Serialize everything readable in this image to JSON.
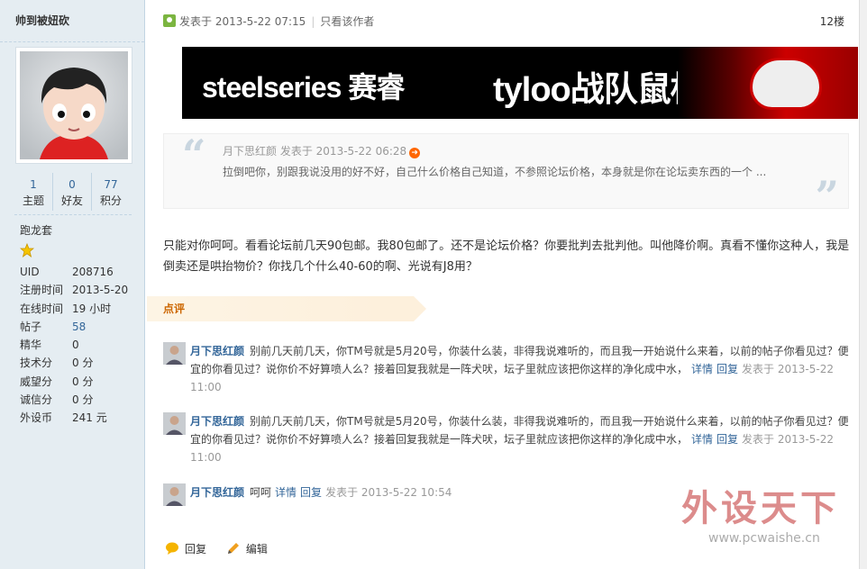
{
  "author": {
    "username": "帅到被妞砍",
    "stats": [
      {
        "value": "1",
        "label": "主题"
      },
      {
        "value": "0",
        "label": "好友"
      },
      {
        "value": "77",
        "label": "积分"
      }
    ],
    "rank": "跑龙套",
    "info": [
      {
        "key": "UID",
        "value": "208716"
      },
      {
        "key": "注册时间",
        "value": "2013-5-20"
      },
      {
        "key": "在线时间",
        "value": "19 小时"
      },
      {
        "key": "帖子",
        "value": "58"
      },
      {
        "key": "精华",
        "value": "0"
      },
      {
        "key": "技术分",
        "value": "0 分"
      },
      {
        "key": "威望分",
        "value": "0 分"
      },
      {
        "key": "诚信分",
        "value": "0 分"
      },
      {
        "key": "外设币",
        "value": "241 元"
      }
    ]
  },
  "post": {
    "posted_at": "发表于 2013-5-22 07:15",
    "only_author": "只看该作者",
    "floor": "12楼",
    "banner_text_1": "steelseries 赛睿",
    "banner_text_2": "tyloo战队鼠标",
    "quote": {
      "author": "月下思红颜",
      "meta": "发表于 2013-5-22 06:28",
      "text": "拉倒吧你，别跟我说没用的好不好，自己什么价格自己知道，不参照论坛价格，本身就是你在论坛卖东西的一个 ..."
    },
    "message": "只能对你呵呵。看看论坛前几天90包邮。我80包邮了。还不是论坛价格？你要批判去批判他。叫他降价啊。真看不懂你这种人，我是倒卖还是哄抬物价？你找几个什么40-60的啊、光说有J8用？"
  },
  "comments_title": "点评",
  "comments": [
    {
      "author": "月下思红颜",
      "text": "别前几天前几天，你TM号就是5月20号，你装什么装，非得我说难听的，而且我一开始说什么来着，以前的帖子你看见过？便宜的你看见过？说你价不好算喷人么？接着回复我就是一阵犬吠，坛子里就应该把你这样的净化成中水，",
      "detail": "详情",
      "reply": "回复",
      "date": "发表于 2013-5-22 11:00"
    },
    {
      "author": "月下思红颜",
      "text": "别前几天前几天，你TM号就是5月20号，你装什么装，非得我说难听的，而且我一开始说什么来着，以前的帖子你看见过？便宜的你看见过？说你价不好算喷人么？接着回复我就是一阵犬吠，坛子里就应该把你这样的净化成中水，",
      "detail": "详情",
      "reply": "回复",
      "date": "发表于 2013-5-22 11:00"
    },
    {
      "author": "月下思红颜",
      "text": "呵呵",
      "detail": "详情",
      "reply": "回复",
      "date": "发表于 2013-5-22 10:54"
    }
  ],
  "footer": {
    "reply": "回复",
    "edit": "编辑"
  },
  "watermark": {
    "title": "外设天下",
    "url": "www.pcwaishe.cn"
  },
  "colors": {
    "sidebar_bg": "#e5edf2",
    "link": "#336699",
    "accent": "#cc6600"
  }
}
